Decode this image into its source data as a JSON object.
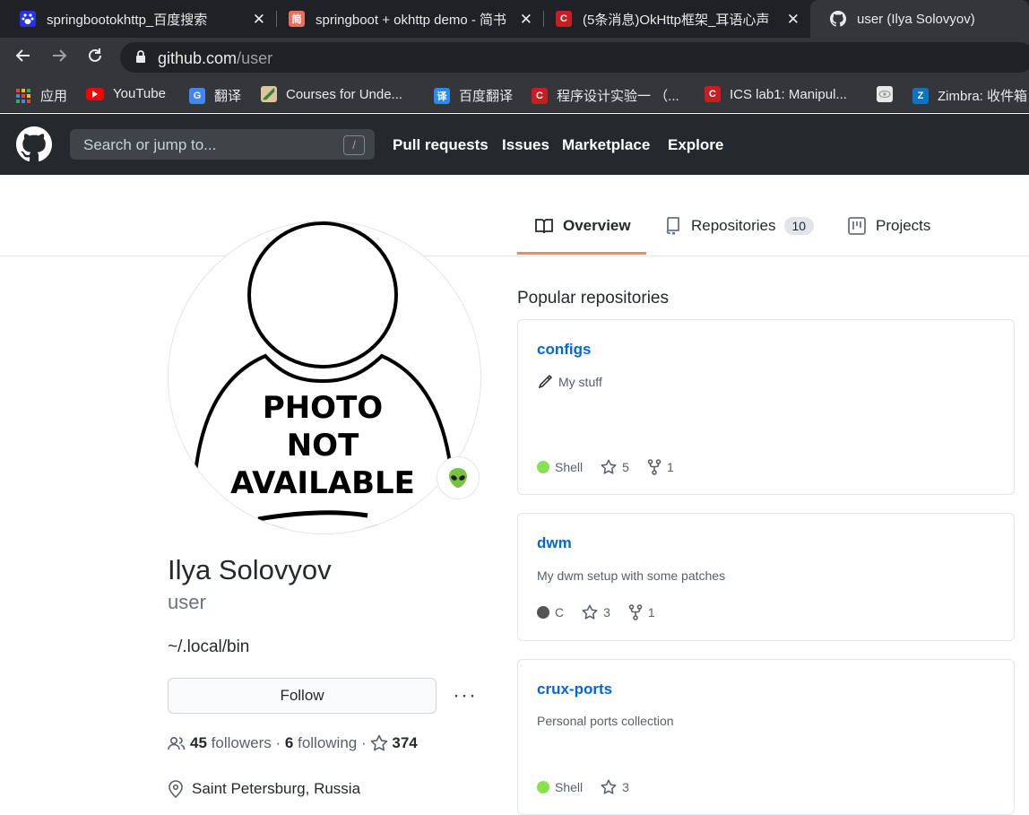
{
  "browser": {
    "tabs": [
      {
        "title": "springbootokhttp_百度搜索",
        "favicon": "baidu-paw-icon",
        "color": "#2932e1"
      },
      {
        "title": "springboot + okhttp demo - 简书",
        "favicon": "jianshu-icon",
        "color": "#ea6f5a"
      },
      {
        "title": "(5条消息)OkHttp框架_耳语心声",
        "favicon": "csdn-icon",
        "color": "#c71d23"
      },
      {
        "title": "user (Ilya Solovyov)",
        "favicon": "github-icon",
        "color": "#ffffff"
      }
    ],
    "close_glyph": "✕",
    "url_host": "github.com",
    "url_path": "/user",
    "bookmarks": [
      {
        "label": "应用",
        "icon": "apps-grid-icon"
      },
      {
        "label": "YouTube",
        "icon": "youtube-icon"
      },
      {
        "label": "翻译",
        "icon": "google-translate-icon"
      },
      {
        "label": "Courses for Unde...",
        "icon": "courses-icon"
      },
      {
        "label": "百度翻译",
        "icon": "baidu-translate-icon"
      },
      {
        "label": "程序设计实验一 （...",
        "icon": "csdn-icon"
      },
      {
        "label": "ICS lab1: Manipul...",
        "icon": "csdn-icon"
      },
      {
        "label": "",
        "icon": "eye-icon"
      },
      {
        "label": "Zimbra: 收件箱",
        "icon": "zimbra-icon"
      }
    ]
  },
  "gh_header": {
    "search_placeholder": "Search or jump to...",
    "search_hotkey": "/",
    "nav": [
      "Pull requests",
      "Issues",
      "Marketplace",
      "Explore"
    ]
  },
  "profile_tabs": {
    "overview": "Overview",
    "repositories": "Repositories",
    "repositories_count": "10",
    "projects": "Projects",
    "active_color": "#f9826c"
  },
  "profile": {
    "avatar_text": [
      "PHOTO",
      "NOT",
      "AVAILABLE"
    ],
    "status_emoji": "alien-icon",
    "fullname": "Ilya Solovyov",
    "login": "user",
    "bio": "~/.local/bin",
    "follow_label": "Follow",
    "more_label": "···",
    "followers_count": "45",
    "followers_label": "followers",
    "sep": "·",
    "following_count": "6",
    "following_label": "following",
    "stars_count": "374",
    "location": "Saint Petersburg, Russia"
  },
  "popular": {
    "title": "Popular repositories",
    "repos": [
      {
        "name": "configs",
        "desc": "My stuff",
        "desc_icon": "pencil-emoji-icon",
        "lang": "Shell",
        "lang_color": "#89e051",
        "stars": "5",
        "forks": "1"
      },
      {
        "name": "dwm",
        "desc": "My dwm setup with some patches",
        "lang": "C",
        "lang_color": "#555555",
        "stars": "3",
        "forks": "1"
      },
      {
        "name": "crux-ports",
        "desc": "Personal ports collection",
        "lang": "Shell",
        "lang_color": "#89e051",
        "stars": "3"
      }
    ]
  }
}
